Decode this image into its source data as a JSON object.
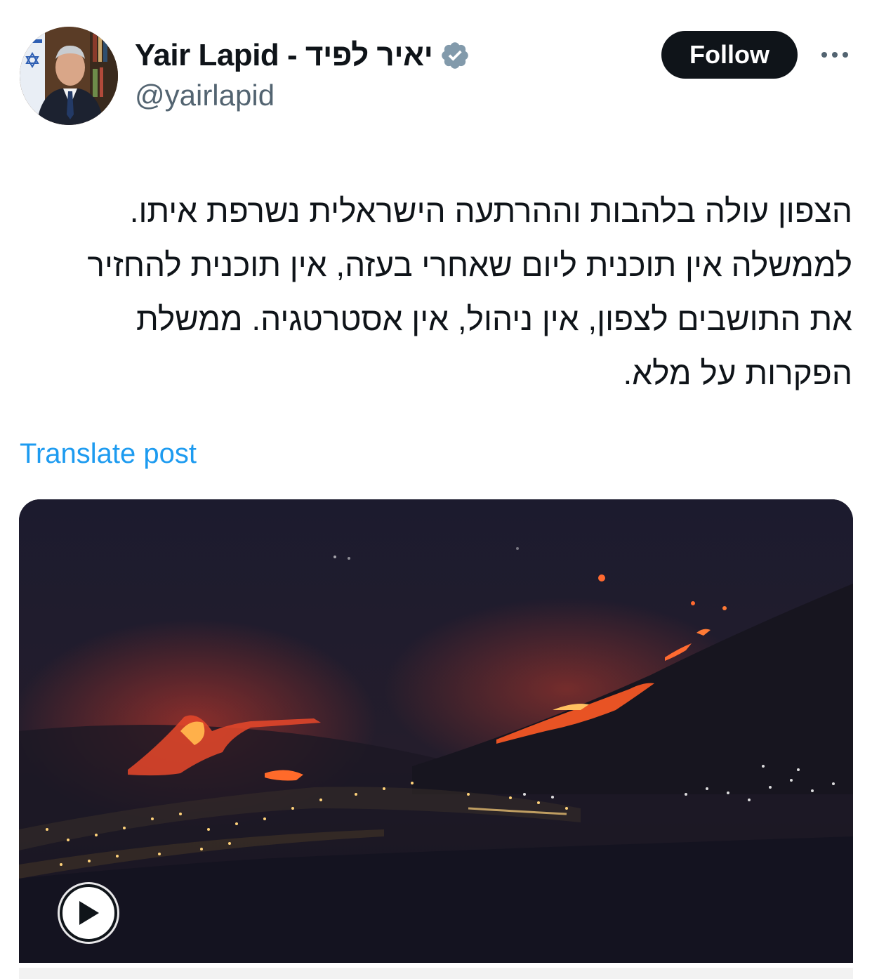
{
  "author": {
    "display_name": "Yair Lapid - יאיר לפיד",
    "handle": "@yairlapid",
    "verified": true,
    "verified_color": "#829aab"
  },
  "actions": {
    "follow_label": "Follow",
    "more_icon": "more-horizontal-icon"
  },
  "post": {
    "lines": [
      "הצפון עולה בלהבות וההרתעה הישראלית נשרפת איתו.",
      "לממשלה אין תוכנית ליום שאחרי בעזה, אין תוכנית להחזיר",
      "את התושבים לצפון, אין ניהול, אין אסטרטגיה. ממשלת",
      "הפקרות על מלא."
    ],
    "translate_label": "Translate post"
  },
  "media": {
    "type": "video",
    "play_icon": "play-icon"
  },
  "colors": {
    "follow_bg": "#0f1419",
    "link": "#1d9bf0",
    "secondary_text": "#536471"
  }
}
